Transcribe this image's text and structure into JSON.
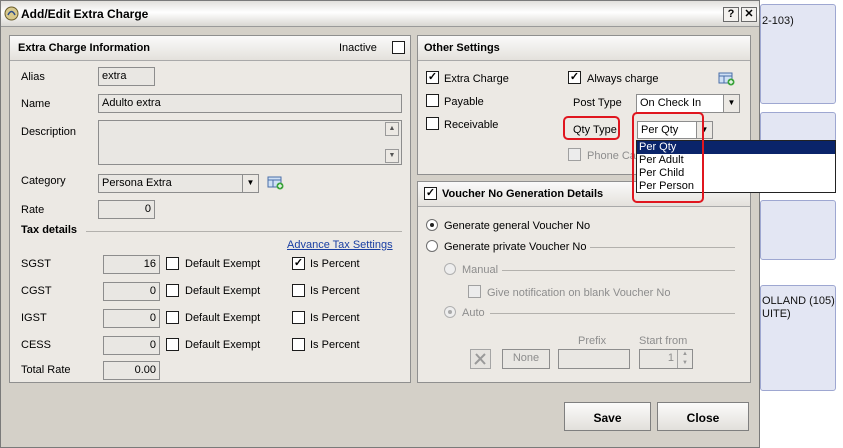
{
  "background": {
    "room_top": "2-103)",
    "room_mid_1": "OLLAND (105)",
    "room_mid_2": "UITE)"
  },
  "window": {
    "title": "Add/Edit Extra Charge",
    "help_label": "?",
    "close_label": "✕"
  },
  "extra_charge_info": {
    "heading": "Extra Charge Information",
    "inactive_label": "Inactive",
    "inactive_checked": false,
    "alias_label": "Alias",
    "alias_value": "extra",
    "name_label": "Name",
    "name_value": "Adulto extra",
    "description_label": "Description",
    "description_value": "",
    "category_label": "Category",
    "category_value": "Persona Extra",
    "rate_label": "Rate",
    "rate_value": "0",
    "tax_heading": "Tax details",
    "advance_tax_link": "Advance Tax Settings",
    "taxes": [
      {
        "label": "SGST",
        "value": "16",
        "default_exempt_label": "Default Exempt",
        "is_percent_label": "Is Percent",
        "default_exempt": false,
        "is_percent": true
      },
      {
        "label": "CGST",
        "value": "0",
        "default_exempt_label": "Default Exempt",
        "is_percent_label": "Is Percent",
        "default_exempt": false,
        "is_percent": false
      },
      {
        "label": "IGST",
        "value": "0",
        "default_exempt_label": "Default Exempt",
        "is_percent_label": "Is Percent",
        "default_exempt": false,
        "is_percent": false
      },
      {
        "label": "CESS",
        "value": "0",
        "default_exempt_label": "Default Exempt",
        "is_percent_label": "Is Percent",
        "default_exempt": false,
        "is_percent": false
      }
    ],
    "total_rate_label": "Total Rate",
    "total_rate_value": "0.00"
  },
  "other_settings": {
    "heading": "Other Settings",
    "extra_charge_label": "Extra Charge",
    "extra_charge_checked": true,
    "always_charge_label": "Always charge",
    "always_charge_checked": true,
    "payable_label": "Payable",
    "payable_checked": false,
    "receivable_label": "Receivable",
    "receivable_checked": false,
    "post_type_label": "Post Type",
    "post_type_value": "On Check In",
    "qty_type_label": "Qty Type",
    "qty_type_value": "Per Qty",
    "phone_call_label": "Phone Cal",
    "qty_type_options": [
      "Per Qty",
      "Per Adult",
      "Per Child",
      "Per Person"
    ],
    "qty_type_selected_index": 0
  },
  "voucher": {
    "heading": "Voucher No Generation Details",
    "heading_checked": true,
    "general_label": "Generate general Voucher No",
    "private_label": "Generate private Voucher No",
    "manual_label": "Manual",
    "notify_label": "Give notification on blank Voucher No",
    "auto_label": "Auto",
    "prefix_label": "Prefix",
    "start_from_label": "Start from",
    "none_label": "None",
    "start_from_value": "1"
  },
  "footer": {
    "save_label": "Save",
    "close_label": "Close"
  },
  "colors": {
    "dialog_bg": "#d4d0c8",
    "panel_bg": "#ece9e4",
    "highlight_red": "#e0161f",
    "selection_blue": "#0a246a",
    "link_blue": "#1a3fa3"
  }
}
